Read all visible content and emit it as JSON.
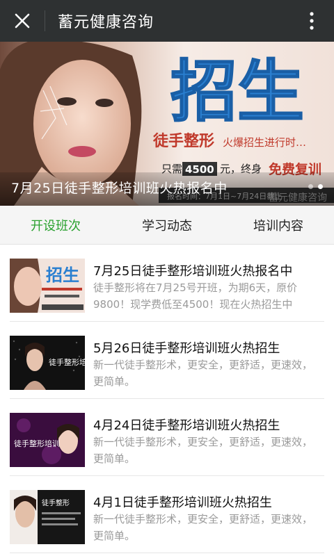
{
  "topbar": {
    "title": "蓄元健康咨询",
    "close_icon": "close-icon",
    "more_icon": "more-vertical-icon"
  },
  "banner": {
    "caption": "7月25日徒手整形培训班火热报名中",
    "image_text": {
      "headline": "招生",
      "line1_strong": "徒手整形",
      "line1_rest": "火爆招生进行时…",
      "price_prefix": "只需",
      "price": "4500",
      "price_suffix": "元，终身",
      "price_highlight": "免费复训",
      "footer": "报名时间：7月1日~7月24日截止",
      "watermark": "蓄元健康咨询"
    },
    "slides_total": 2,
    "active_slide": 1
  },
  "tabs": [
    {
      "label": "开设班次",
      "active": true
    },
    {
      "label": "学习动态",
      "active": false
    },
    {
      "label": "培训内容",
      "active": false
    }
  ],
  "articles": [
    {
      "title": "7月25日徒手整形培训班火热报名中",
      "desc": "徒手整形将在7月25号开班，为期6天，原价9800！现学费低至4500！现在火热招生中",
      "thumb_text": "招生"
    },
    {
      "title": "5月26日徒手整形培训班火热招生",
      "desc": "新一代徒手整形术，更安全，更舒适，更速效，更简单。",
      "thumb_text": "徒手整形培训"
    },
    {
      "title": "4月24日徒手整形培训班火热招生",
      "desc": "新一代徒手整形术，更安全，更舒适，更速效，更简单。",
      "thumb_text": "徒手整形培训"
    },
    {
      "title": "4月1日徒手整形培训班火热招生",
      "desc": "新一代徒手整形术，更安全，更舒适，更速效，更简单。",
      "thumb_text": "徒手整形"
    }
  ],
  "colors": {
    "topbar": "#2e3132",
    "active_tab": "#2aa12f",
    "banner_headline": "#2a7fd0",
    "banner_accent": "#c0392b"
  }
}
